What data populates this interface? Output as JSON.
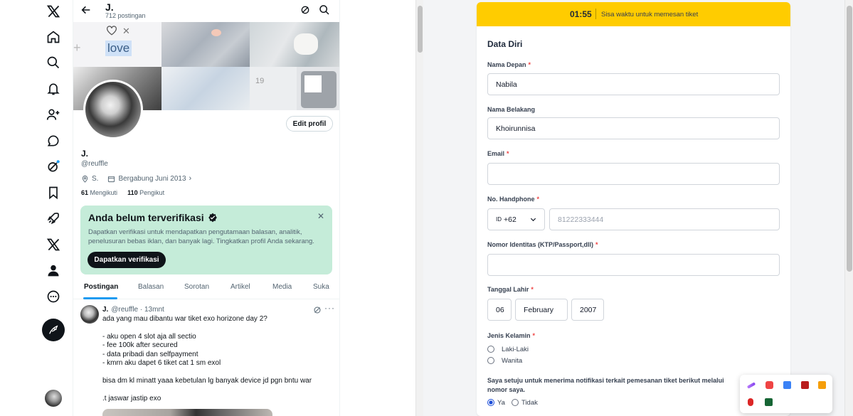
{
  "nav": {
    "items": [
      "x-logo-icon",
      "home-icon",
      "search-icon",
      "notifications-icon",
      "follow-icon",
      "messages-icon",
      "grok-icon",
      "bookmarks-icon",
      "rocket-icon",
      "x-premium-icon",
      "profile-icon",
      "more-icon"
    ],
    "compose_icon": "compose-icon"
  },
  "profile": {
    "top_name": "J.",
    "post_count": "712 postingan",
    "banner_text": "love",
    "edit_button": "Edit profil",
    "display_name": "J.",
    "handle": "@reuffle",
    "location": "S.",
    "joined": "Bergabung Juni 2013",
    "following_count": "61",
    "following_label": "Mengikuti",
    "followers_count": "110",
    "followers_label": "Pengikut",
    "verify": {
      "title": "Anda belum terverifikasi",
      "description": "Dapatkan verifikasi untuk mendapatkan pengutamaan balasan, analitik, penelusuran bebas iklan, dan banyak lagi. Tingkatkan profil Anda sekarang.",
      "button": "Dapatkan verifikasi"
    },
    "tabs": [
      "Postingan",
      "Balasan",
      "Sorotan",
      "Artikel",
      "Media",
      "Suka"
    ],
    "tweet": {
      "name": "J.",
      "meta": "@reuffle · 13mnt",
      "lines": [
        "ada yang mau dibantu war tiket exo horizone day 2?",
        "- aku open 4 slot aja all sectio",
        "- fee 100k after secured",
        "- data pribadi dan selfpayment",
        "- kmrn aku dapet 6 tiket cat 1 sm exol",
        "bisa dm kl minatt yaaa kebetulan lg banyak device jd pgn bntu war",
        ".t jaswar jastip exo"
      ]
    }
  },
  "form": {
    "timer": "01:55",
    "timer_text": "Sisa waktu untuk memesan tiket",
    "section_title": "Data Diri",
    "first_name_label": "Nama Depan",
    "first_name_value": "Nabila",
    "last_name_label": "Nama Belakang",
    "last_name_value": "Khoirunnisa",
    "email_label": "Email",
    "email_value": "",
    "phone_label": "No. Handphone",
    "country_flag": "ID",
    "country_code": "+62",
    "phone_placeholder": "81222333444",
    "id_label": "Nomor Identitas (KTP/Passport,dll)",
    "id_value": "",
    "dob_label": "Tanggal Lahir",
    "dob_day": "06",
    "dob_month": "February",
    "dob_year": "2007",
    "gender_label": "Jenis Kelamin",
    "gender_options": [
      "Laki-Laki",
      "Wanita"
    ],
    "gender_selected": "",
    "consent_text": "Saya setuju untuk menerima notifikasi terkait pemesanan tiket berikut melalui nomor saya.",
    "consent_options": [
      "Ya",
      "Tidak"
    ],
    "consent_selected": "Ya"
  },
  "colors": {
    "accent_blue": "#1d9bf0",
    "timer_yellow": "#ffcc00",
    "verify_green": "#c5ecd9",
    "required_red": "#ef4444"
  }
}
